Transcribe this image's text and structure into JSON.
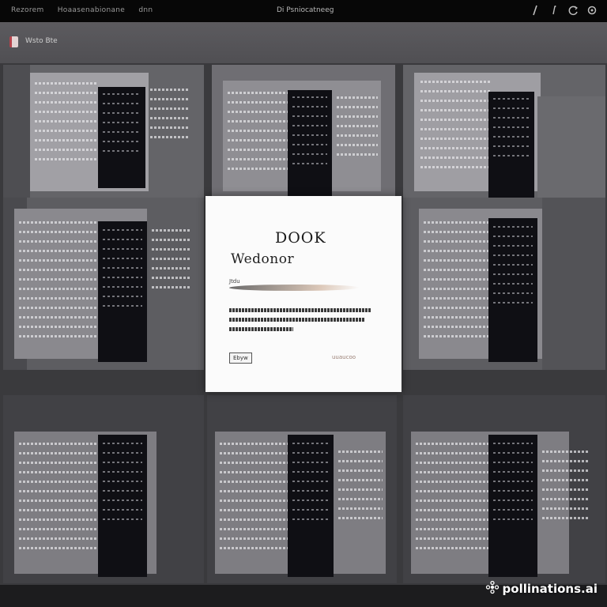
{
  "topbar": {
    "left_items": [
      "Rezorem",
      "Hoaasenabionane",
      "dnn"
    ],
    "center_title": "Di Psniocatneeg",
    "icons": [
      "slash-icon",
      "info-icon",
      "refresh-icon",
      "settings-icon"
    ]
  },
  "subbar": {
    "label": "Wsto Bte"
  },
  "dialog": {
    "title": "DOOK",
    "subtitle": "Wedonor",
    "caption": "Jtdu",
    "left_button": "Ebyw",
    "right_button": "uuaucoo"
  },
  "watermark": {
    "text": "pollinations.ai",
    "icon": "pollinations-logo-icon"
  },
  "colors": {
    "background": "#2b2b2d",
    "topbar": "#070707",
    "subbar": "#56555a",
    "tile": "#646468",
    "dark_column": "#0f0f14",
    "dialog": "#fbfbfb"
  }
}
